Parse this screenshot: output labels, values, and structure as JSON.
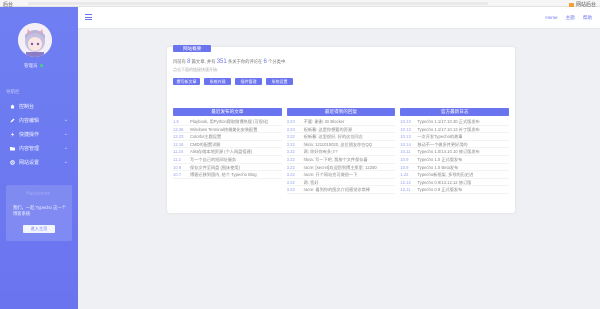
{
  "browser": {
    "left_text": "后台",
    "right_text": "网站后台"
  },
  "sidebar": {
    "username": "管理员",
    "section": "导航栏",
    "items": [
      {
        "label": "控制台",
        "icon": "home-icon",
        "has_sub": false
      },
      {
        "label": "内容编辑",
        "icon": "edit-icon",
        "has_sub": true
      },
      {
        "label": "快捷操作",
        "icon": "lightning-icon",
        "has_sub": true
      },
      {
        "label": "内容管理",
        "icon": "folder-icon",
        "has_sub": true
      },
      {
        "label": "网站设置",
        "icon": "gear-icon",
        "has_sub": true
      }
    ],
    "card": {
      "ghost": "Handsome",
      "text": "我们，一起 Typecho 这一个博客系统",
      "button": "进入主页"
    }
  },
  "topbar": {
    "links": [
      "Home",
      "主题",
      "帮助"
    ]
  },
  "panel": {
    "badge": "网站概要",
    "summary_prefix": "目前有",
    "summary_posts": "8",
    "summary_mid1": "篇文章, 并有",
    "summary_comments": "351",
    "summary_mid2": "条关于你的评论在",
    "summary_cats": "6",
    "summary_suffix": "个分类中.",
    "note": "点击下面的链接快速开始:",
    "buttons": [
      "撰写新文章",
      "系统外观",
      "插件管理",
      "系统设置"
    ]
  },
  "columns": [
    {
      "title": "最近发布的文章",
      "rows": [
        {
          "date": "1.5",
          "text": "Playbook, 用Python爬取微博热搜 (可视化)"
        },
        {
          "date": "12.26",
          "text": "Windows Terminal终端美化安装配置"
        },
        {
          "date": "12.23",
          "text": "Colorful主题设置"
        },
        {
          "date": "12.16",
          "text": "CMD的配置详解"
        },
        {
          "date": "11.24",
          "text": "Alist存储本地资源 (个人网盘搭建)"
        },
        {
          "date": "11.2",
          "text": "写一个自己的短网址服务"
        },
        {
          "date": "10.8",
          "text": "保存文件至网盘 (图床使用)"
        },
        {
          "date": "10.7",
          "text": "博客迁移到国内, 给个 Typecho Blog"
        }
      ]
    },
    {
      "title": "最近得到的回复",
      "rows": [
        {
          "date": "3.24",
          "text": "不要: 谢谢. Br Blocker"
        },
        {
          "date": "3.23",
          "text": "祝新春: 这是你想要的资源"
        },
        {
          "date": "3.22",
          "text": "祝新春: 这里很好, 好的这位同志"
        },
        {
          "date": "3.22",
          "text": "hkria: 1211015020, 这位朋友你在QQ"
        },
        {
          "date": "3.22",
          "text": "两: 你好你有多少?"
        },
        {
          "date": "3.22",
          "text": "hkria: 写一下吧, 我按个文件保存着"
        },
        {
          "date": "3.22",
          "text": "racre: [secret]欢迎您到博主那里: 12250"
        },
        {
          "date": "3.22",
          "text": "racre: 开个网站也可做很一下"
        },
        {
          "date": "3.22",
          "text": "两: 您好"
        },
        {
          "date": "3.22",
          "text": "racre: 看到你的图文介绍感觉非常棒"
        }
      ]
    },
    {
      "title": "官方最新日志",
      "rows": [
        {
          "date": "10.13",
          "text": "Typecho 1.1/17.10.30 正式版发布"
        },
        {
          "date": "10.13",
          "text": "Typecho 1.1/17.10.13 补丁版发布"
        },
        {
          "date": "10.13",
          "text": "一次开发Typecho的故事"
        },
        {
          "date": "10.14",
          "text": "移动不一个做多并更好用的"
        },
        {
          "date": "10.11",
          "text": "Typecho 1.0/14.10.10 修订版发布"
        },
        {
          "date": "10.9",
          "text": "Typecho 1.0 正式版发布"
        },
        {
          "date": "10.9",
          "text": "Typecho 1.0 Beta发布"
        },
        {
          "date": "1.22",
          "text": "Typecho新框架, 多领的历史进"
        },
        {
          "date": "12.12",
          "text": "Typecho 0.9/13.12.12 修订版"
        },
        {
          "date": "12.11",
          "text": "Typecho 0.9 正式版发布"
        }
      ]
    }
  ],
  "colors": {
    "accent": "#6a74ef",
    "sidebar": "#6f7ff2",
    "background": "#eef0f3"
  }
}
